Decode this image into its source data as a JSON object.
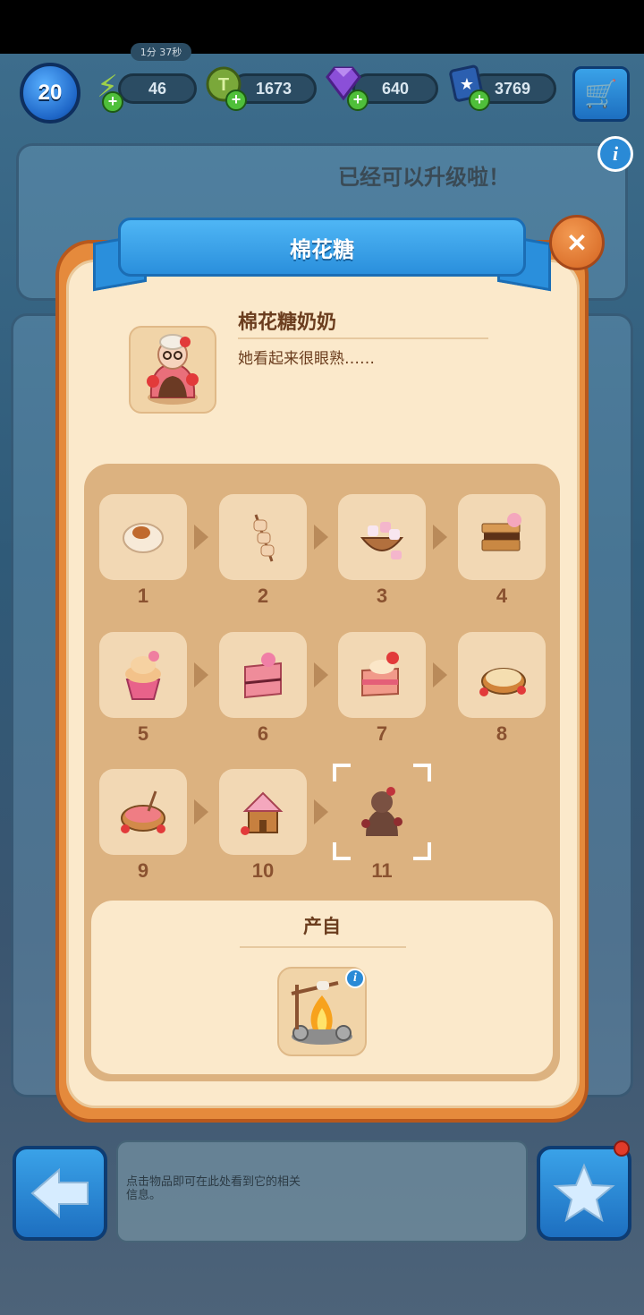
{
  "hud": {
    "level": "20",
    "energy": "46",
    "energy_timer": "1分 37秒",
    "coins": "1673",
    "gems": "640",
    "cards": "3769",
    "upgrade_hint": "已经可以升级啦！"
  },
  "modal": {
    "title": "棉花糖",
    "item": {
      "name": "棉花糖奶奶",
      "description": "她看起来很眼熟……"
    },
    "chain": [
      {
        "level": "1",
        "icon": "toasted-marshmallow-icon"
      },
      {
        "level": "2",
        "icon": "marshmallow-skewer-icon"
      },
      {
        "level": "3",
        "icon": "marshmallow-bowl-icon"
      },
      {
        "level": "4",
        "icon": "smores-stack-icon"
      },
      {
        "level": "5",
        "icon": "cupcake-icon"
      },
      {
        "level": "6",
        "icon": "layer-cake-slice-icon"
      },
      {
        "level": "7",
        "icon": "strawberry-cake-slice-icon"
      },
      {
        "level": "8",
        "icon": "meringue-pie-icon"
      },
      {
        "level": "9",
        "icon": "strawberry-pie-icon"
      },
      {
        "level": "10",
        "icon": "gingerbread-house-icon"
      },
      {
        "level": "11",
        "icon": "marshmallow-grandma-silhouette-icon"
      }
    ],
    "source": {
      "title": "产自",
      "icon": "campfire-roaster-icon"
    }
  },
  "bottom": {
    "hint": "点击物品即可在此处看到它的相关信息。"
  },
  "colors": {
    "modal_orange": "#e58a3c",
    "panel_cream": "#fbe9cb",
    "chain_tan": "#dcb280",
    "ribbon_blue": "#2a8fdc",
    "text_brown": "#6b3d1e"
  }
}
